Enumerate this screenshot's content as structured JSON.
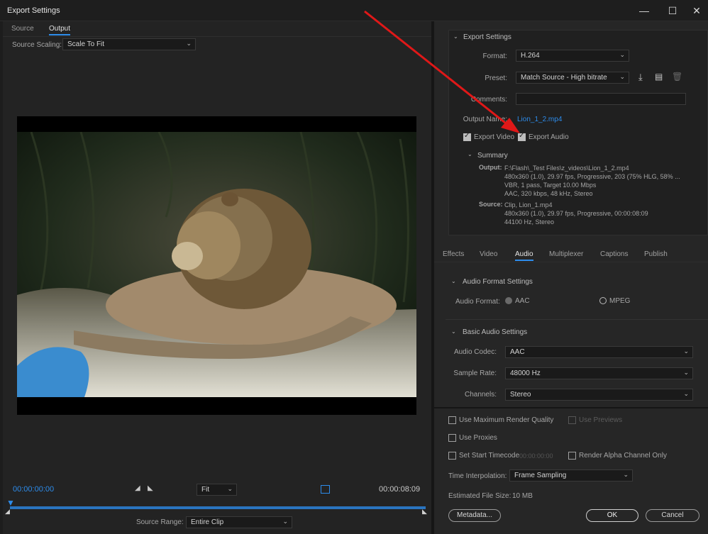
{
  "window": {
    "title": "Export Settings",
    "minimize": "—",
    "maximize": "☐",
    "close": "✕"
  },
  "left": {
    "tabs": [
      {
        "label": "Source"
      },
      {
        "label": "Output"
      }
    ],
    "source_scaling": {
      "label": "Source Scaling:",
      "value": "Scale To Fit"
    },
    "timecode_start": "00:00:00:00",
    "timecode_end": "00:00:08:09",
    "zoom": {
      "value": "Fit"
    },
    "source_range": {
      "label": "Source Range:",
      "value": "Entire Clip"
    }
  },
  "export_settings": {
    "title": "Export Settings",
    "format": {
      "label": "Format:",
      "value": "H.264"
    },
    "preset": {
      "label": "Preset:",
      "value": "Match Source - High bitrate"
    },
    "comments": {
      "label": "Comments:",
      "value": ""
    },
    "output_name": {
      "label": "Output Name:",
      "value": "Lion_1_2.mp4"
    },
    "export_video": {
      "label": "Export Video",
      "checked": true
    },
    "export_audio": {
      "label": "Export Audio",
      "checked": true
    },
    "summary": {
      "title": "Summary",
      "output_label": "Output:",
      "output_lines": [
        "F:\\Flash\\_Test Files\\z_videos\\Lion_1_2.mp4",
        "480x360 (1.0), 29.97 fps, Progressive, 203 (75% HLG, 58% ...",
        "VBR, 1 pass, Target 10.00 Mbps",
        "AAC, 320 kbps, 48 kHz, Stereo"
      ],
      "source_label": "Source:",
      "source_lines": [
        "Clip, Lion_1.mp4",
        "480x360 (1.0), 29.97 fps, Progressive, 00:00:08:09",
        "44100 Hz, Stereo"
      ]
    }
  },
  "right_tabs": [
    {
      "label": "Effects"
    },
    {
      "label": "Video"
    },
    {
      "label": "Audio"
    },
    {
      "label": "Multiplexer"
    },
    {
      "label": "Captions"
    },
    {
      "label": "Publish"
    }
  ],
  "audio": {
    "format_settings_title": "Audio Format Settings",
    "audio_format_label": "Audio Format:",
    "opt_aac": "AAC",
    "opt_mpeg": "MPEG",
    "basic_title": "Basic Audio Settings",
    "codec": {
      "label": "Audio Codec:",
      "value": "AAC"
    },
    "sample_rate": {
      "label": "Sample Rate:",
      "value": "48000 Hz"
    },
    "channels": {
      "label": "Channels:",
      "value": "Stereo"
    }
  },
  "bottom": {
    "max_render": "Use Maximum Render Quality",
    "use_previews": "Use Previews",
    "use_proxies": "Use Proxies",
    "set_start_tc": "Set Start Timecode",
    "start_tc_value": "00:00:00:00",
    "render_alpha": "Render Alpha Channel Only",
    "time_interp": {
      "label": "Time Interpolation:",
      "value": "Frame Sampling"
    },
    "est_size_label": "Estimated File Size:",
    "est_size_value": "10 MB",
    "metadata_btn": "Metadata...",
    "ok_btn": "OK",
    "cancel_btn": "Cancel"
  },
  "colors": {
    "accent": "#2d8ceb",
    "annotation_arrow": "#e01818"
  }
}
